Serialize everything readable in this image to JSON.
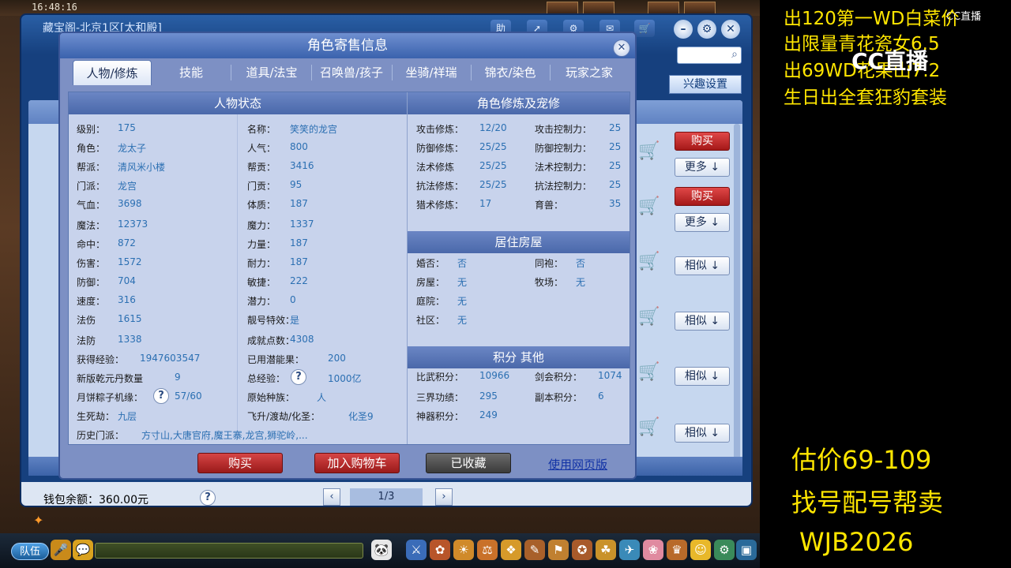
{
  "scene": {
    "clock": "16:48:16"
  },
  "treasure_window": {
    "title": "藏宝阁-北京1区[太和殿]",
    "help_btn": "助",
    "interest_btn": "兴趣设置",
    "row_buttons": [
      "购买",
      "更多",
      "购买",
      "更多",
      "相似",
      "相似",
      "相似",
      "相似"
    ],
    "wallet": "钱包余额：360.00元",
    "pager": "1/3"
  },
  "dialog": {
    "title": "角色寄售信息",
    "tabs": [
      "人物/修炼",
      "技能",
      "道具/法宝",
      "召唤兽/孩子",
      "坐骑/祥瑞",
      "锦衣/染色",
      "玩家之家"
    ],
    "panels": {
      "status": "人物状态",
      "cultivation": "角色修炼及宠修",
      "house": "居住房屋",
      "points": "积分 其他"
    },
    "status_left": [
      {
        "k": "级别：",
        "v": "175"
      },
      {
        "k": "角色：",
        "v": "龙太子"
      },
      {
        "k": "帮派：",
        "v": "清风米小楼"
      },
      {
        "k": "门派：",
        "v": "龙宫"
      },
      {
        "k": "气血：",
        "v": "3698"
      },
      {
        "k": "魔法：",
        "v": "12373"
      },
      {
        "k": "命中：",
        "v": "872"
      },
      {
        "k": "伤害：",
        "v": "1572"
      },
      {
        "k": "防御：",
        "v": "704"
      },
      {
        "k": "速度：",
        "v": "316"
      },
      {
        "k": "法伤",
        "v": "1615"
      },
      {
        "k": "法防",
        "v": "1338"
      },
      {
        "k": "获得经验：",
        "v": "1947603547"
      },
      {
        "k": "新版乾元丹数量",
        "v": "9"
      },
      {
        "k": "月饼粽子机缘：",
        "v": "57/60"
      },
      {
        "k": "生死劫：",
        "v": "九层"
      }
    ],
    "status_right": [
      {
        "k": "名称：",
        "v": "笑笑的龙宫"
      },
      {
        "k": "人气：",
        "v": "800"
      },
      {
        "k": "帮贡：",
        "v": "3416"
      },
      {
        "k": "门贡：",
        "v": "95"
      },
      {
        "k": "体质：",
        "v": "187"
      },
      {
        "k": "魔力：",
        "v": "1337"
      },
      {
        "k": "力量：",
        "v": "187"
      },
      {
        "k": "耐力：",
        "v": "187"
      },
      {
        "k": "敏捷：",
        "v": "222"
      },
      {
        "k": "潜力：",
        "v": "0"
      },
      {
        "k": "靓号特效：",
        "v": "是"
      },
      {
        "k": "成就点数：",
        "v": "4308"
      },
      {
        "k": "已用潜能果：",
        "v": "200"
      },
      {
        "k": "总经验：",
        "v": "1000亿"
      },
      {
        "k": "原始种族：",
        "v": "人"
      },
      {
        "k": "飞升/渡劫/化圣：",
        "v": "化圣9"
      }
    ],
    "history": {
      "k": "历史门派：",
      "v": "方寸山,大唐官府,魔王寨,龙宫,狮驼岭,..."
    },
    "cultivation": [
      {
        "k": "攻击修炼：",
        "v": "12/20",
        "k2": "攻击控制力：",
        "v2": "25"
      },
      {
        "k": "防御修炼：",
        "v": "25/25",
        "k2": "防御控制力：",
        "v2": "25"
      },
      {
        "k": "法术修炼",
        "v": "25/25",
        "k2": "法术控制力：",
        "v2": "25"
      },
      {
        "k": "抗法修炼：",
        "v": "25/25",
        "k2": "抗法控制力：",
        "v2": "25"
      },
      {
        "k": "猎术修炼：",
        "v": "17",
        "k2": "育兽：",
        "v2": "35"
      }
    ],
    "house": [
      {
        "k": "婚否：",
        "v": "否",
        "k2": "同袍：",
        "v2": "否"
      },
      {
        "k": "房屋：",
        "v": "无",
        "k2": "牧场：",
        "v2": "无"
      },
      {
        "k": "庭院：",
        "v": "无",
        "k2": "",
        "v2": ""
      },
      {
        "k": "社区：",
        "v": "无",
        "k2": "",
        "v2": ""
      }
    ],
    "points": [
      {
        "k": "比武积分：",
        "v": "10966",
        "k2": "剑会积分：",
        "v2": "1074"
      },
      {
        "k": "三界功绩：",
        "v": "295",
        "k2": "副本积分：",
        "v2": "6"
      },
      {
        "k": "神器积分：",
        "v": "249",
        "k2": "",
        "v2": ""
      }
    ],
    "buttons": {
      "buy": "购买",
      "cart": "加入购物车",
      "saved": "已收藏",
      "web": "使用网页版"
    }
  },
  "game_bar": {
    "team": "队伍"
  },
  "overlay": {
    "cc_logo": "CC直播",
    "cc_small": "CC直播",
    "promos": [
      "出120第一WD白菜价",
      "出限量青花瓷女6.5",
      "出69WD花果山7.2",
      "生日出全套狂豹套装"
    ],
    "price": "估价69-109",
    "service": "找号配号帮卖",
    "contact": "WJB2026"
  },
  "colors": {
    "accent_yellow": "#ffe600",
    "dialog_blue": "#3a62ad",
    "buy_red": "#a51818",
    "value_blue": "#2b6fb2"
  }
}
